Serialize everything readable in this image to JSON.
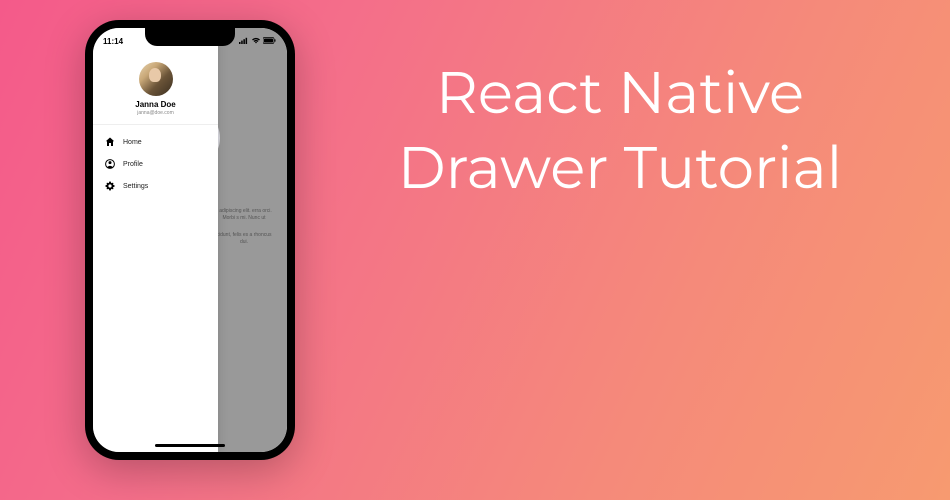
{
  "title": "React Native Drawer Tutorial",
  "phone": {
    "status": {
      "time": "11:14"
    },
    "drawer": {
      "user": {
        "name": "Janna Doe",
        "email": "janna@doe.com"
      },
      "items": [
        {
          "icon": "home-icon",
          "label": "Home"
        },
        {
          "icon": "profile-icon",
          "label": "Profile"
        },
        {
          "icon": "settings-icon",
          "label": "Settings"
        }
      ]
    },
    "background": {
      "text1": "r adipiscing elit.\nerra orci. Morbi\ns mi. Nunc ut",
      "text2": "cidunt, felis es\na rhoncus dui."
    }
  }
}
